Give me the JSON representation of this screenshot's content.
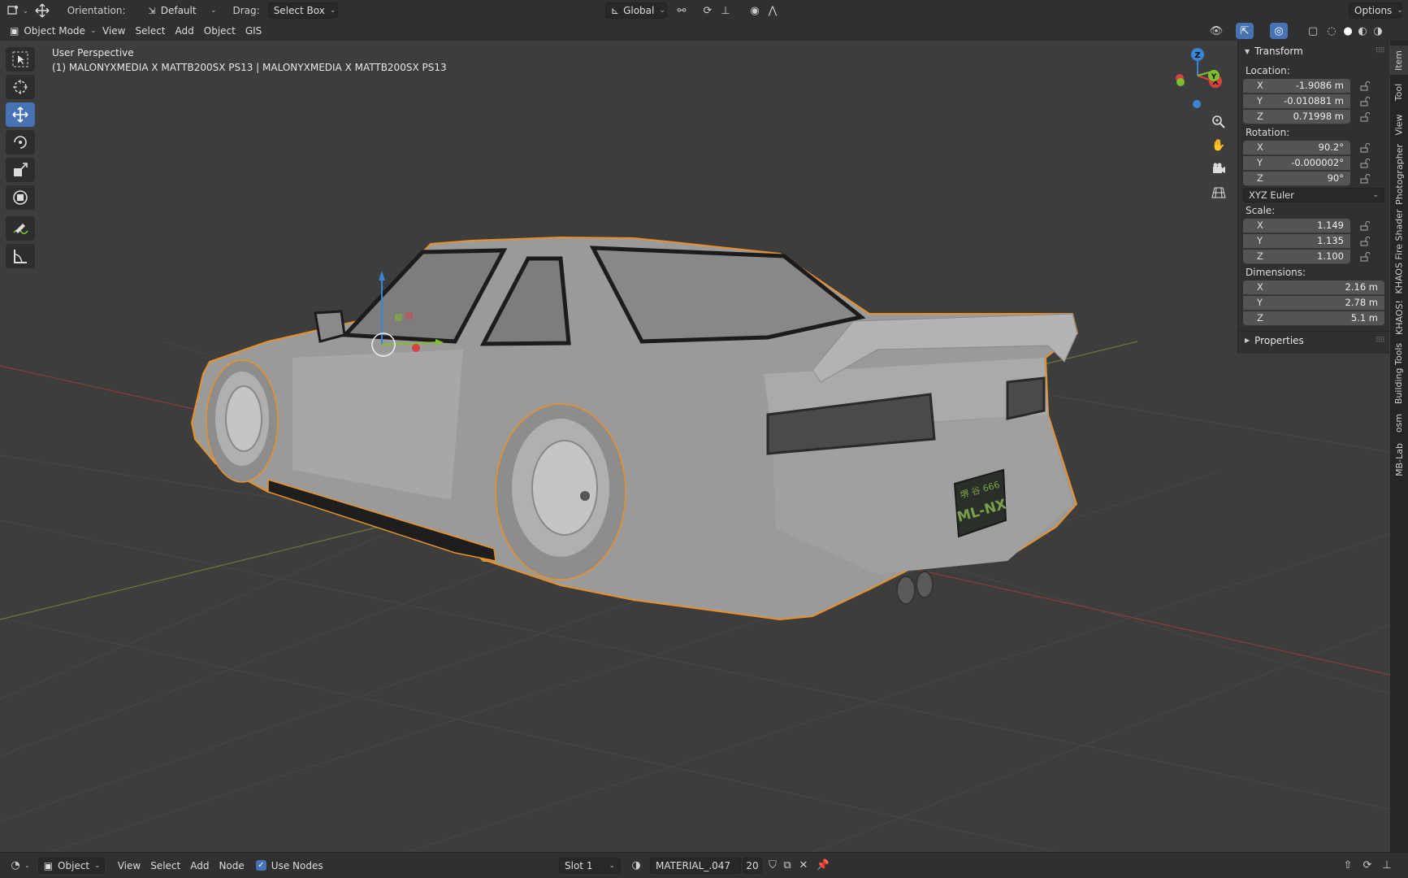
{
  "header": {
    "orientation_label": "Orientation:",
    "orientation_value": "Default",
    "drag_label": "Drag:",
    "drag_value": "Select Box",
    "transform_space": "Global",
    "options_label": "Options"
  },
  "menu": {
    "mode": "Object Mode",
    "items": [
      "View",
      "Select",
      "Add",
      "Object",
      "GIS"
    ]
  },
  "viewport": {
    "view_name": "User Perspective",
    "object_info": "(1) MALONYXMEDIA X MATTB200SX PS13 | MALONYXMEDIA X MATTB200SX PS13",
    "plate_line1": "堺 谷 666",
    "plate_line2": "ML-NX",
    "gizmo_axes": {
      "x": "X",
      "y": "Y",
      "z": "Z"
    }
  },
  "toolbar": {
    "tools": [
      "select-box",
      "cursor",
      "move",
      "rotate",
      "scale",
      "transform",
      "annotate",
      "measure"
    ],
    "active": "move"
  },
  "npanel": {
    "transform_title": "Transform",
    "location_label": "Location:",
    "location": [
      {
        "axis": "X",
        "value": "-1.9086 m"
      },
      {
        "axis": "Y",
        "value": "-0.010881 m"
      },
      {
        "axis": "Z",
        "value": "0.71998 m"
      }
    ],
    "rotation_label": "Rotation:",
    "rotation": [
      {
        "axis": "X",
        "value": "90.2°"
      },
      {
        "axis": "Y",
        "value": "-0.000002°"
      },
      {
        "axis": "Z",
        "value": "90°"
      }
    ],
    "rotation_mode": "XYZ Euler",
    "scale_label": "Scale:",
    "scale": [
      {
        "axis": "X",
        "value": "1.149"
      },
      {
        "axis": "Y",
        "value": "1.135"
      },
      {
        "axis": "Z",
        "value": "1.100"
      }
    ],
    "dimensions_label": "Dimensions:",
    "dimensions": [
      {
        "axis": "X",
        "value": "2.16 m"
      },
      {
        "axis": "Y",
        "value": "2.78 m"
      },
      {
        "axis": "Z",
        "value": "5.1 m"
      }
    ],
    "properties_title": "Properties"
  },
  "side_tabs": [
    "Item",
    "Tool",
    "View",
    "Photographer",
    "KHAOS Fire Shader",
    "KHAOS!",
    "Building Tools",
    "osm",
    "MB-Lab"
  ],
  "bottom": {
    "editor_mode": "Object",
    "items": [
      "View",
      "Select",
      "Add",
      "Node"
    ],
    "use_nodes_label": "Use Nodes",
    "use_nodes_checked": true,
    "slot": "Slot 1",
    "material_name": "MATERIAL_.047",
    "user_count": "20"
  },
  "colors": {
    "accent": "#4772b3",
    "selection_outline": "#e8902a",
    "axis_x": "#d9413f",
    "axis_y": "#7fbf2e",
    "axis_z": "#3a84d6"
  }
}
